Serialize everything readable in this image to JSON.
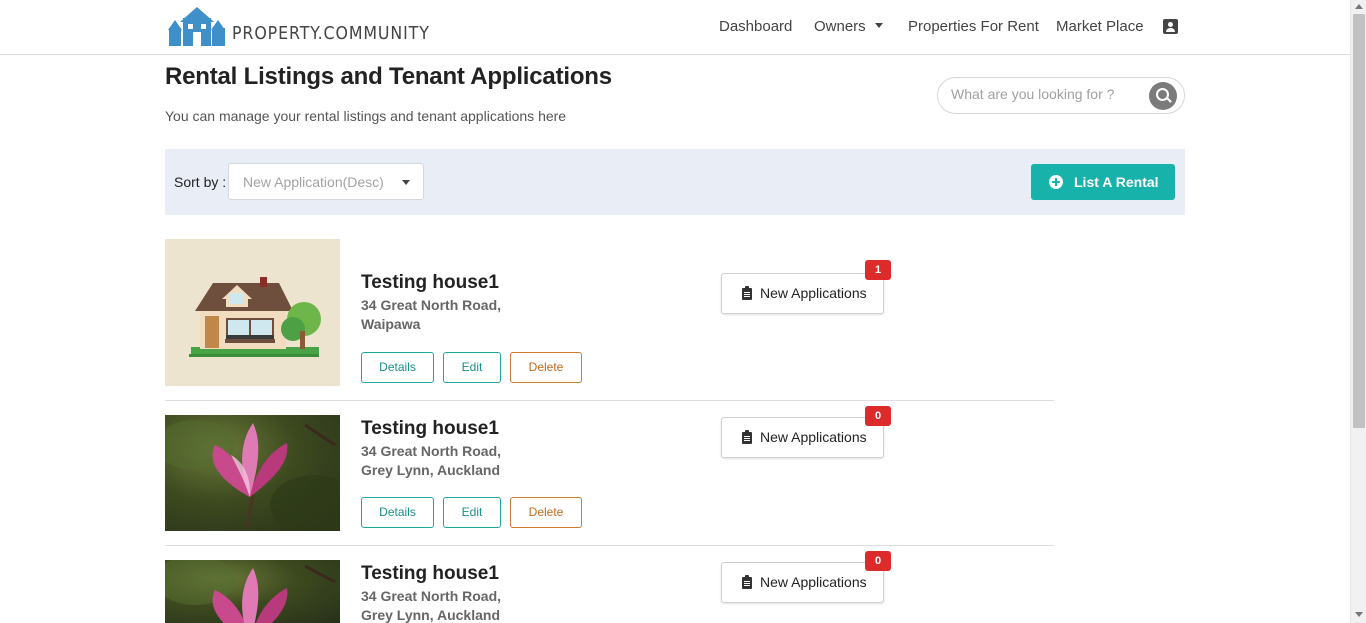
{
  "brand": {
    "name": "PROPERTY.COMMUNITY",
    "color": "#3f8fc9"
  },
  "nav": {
    "dashboard": "Dashboard",
    "owners": "Owners",
    "properties_for_rent": "Properties For Rent",
    "market_place": "Market Place",
    "account_icon": "contact-icon"
  },
  "header": {
    "title": "Rental Listings and Tenant Applications",
    "subtitle": "You can manage your rental listings and tenant applications here"
  },
  "search": {
    "placeholder": "What are you looking for ?",
    "value": ""
  },
  "sort": {
    "label": "Sort by :",
    "selected": "New Application(Desc)"
  },
  "list_button": {
    "label": "List A Rental",
    "color": "#17b3aa"
  },
  "actions": {
    "details": "Details",
    "edit": "Edit",
    "delete": "Delete",
    "applications": "New Applications"
  },
  "listings": [
    {
      "title": "Testing house1",
      "address_line1": "34 Great North Road,",
      "address_line2": "Waipawa",
      "new_applications": "1",
      "image": "house-illustration"
    },
    {
      "title": "Testing house1",
      "address_line1": "34 Great North Road,",
      "address_line2": "Grey Lynn, Auckland",
      "new_applications": "0",
      "image": "magnolia-flower-photo"
    },
    {
      "title": "Testing house1",
      "address_line1": "34 Great North Road,",
      "address_line2": "Grey Lynn, Auckland",
      "new_applications": "0",
      "image": "magnolia-flower-photo"
    }
  ]
}
